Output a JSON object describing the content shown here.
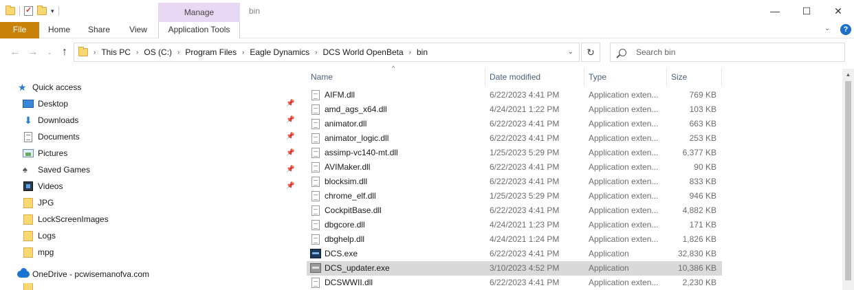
{
  "window": {
    "title": "bin",
    "context_tab": "Manage",
    "controls": {
      "minimize": "—",
      "maximize": "☐",
      "close": "✕"
    }
  },
  "ribbon": {
    "tabs": [
      {
        "label": "File"
      },
      {
        "label": "Home"
      },
      {
        "label": "Share"
      },
      {
        "label": "View"
      },
      {
        "label": "Application Tools"
      }
    ],
    "help_label": "?",
    "accent_color": "#c9830a",
    "context_color": "#e8d8f3"
  },
  "address": {
    "breadcrumbs": [
      "This PC",
      "OS (C:)",
      "Program Files",
      "Eagle Dynamics",
      "DCS World OpenBeta",
      "bin"
    ],
    "search_placeholder": "Search bin"
  },
  "nav_pane": {
    "quick_access_label": "Quick access",
    "items": [
      {
        "label": "Desktop",
        "icon": "desktop-icon",
        "pinned": true
      },
      {
        "label": "Downloads",
        "icon": "download-icon",
        "pinned": true
      },
      {
        "label": "Documents",
        "icon": "documents-icon",
        "pinned": true
      },
      {
        "label": "Pictures",
        "icon": "pictures-icon",
        "pinned": true
      },
      {
        "label": "Saved Games",
        "icon": "saved-games-icon",
        "pinned": true
      },
      {
        "label": "Videos",
        "icon": "videos-icon",
        "pinned": true
      },
      {
        "label": "JPG",
        "icon": "folder-icon",
        "pinned": false
      },
      {
        "label": "LockScreenImages",
        "icon": "folder-icon",
        "pinned": false
      },
      {
        "label": "Logs",
        "icon": "folder-icon",
        "pinned": false
      },
      {
        "label": "mpg",
        "icon": "folder-icon",
        "pinned": false
      }
    ],
    "onedrive_label": "OneDrive - pcwisemanofva.com"
  },
  "file_list": {
    "columns": {
      "name": "Name",
      "date": "Date modified",
      "type": "Type",
      "size": "Size"
    },
    "rows": [
      {
        "name": "AIFM.dll",
        "date": "6/22/2023 4:41 PM",
        "type": "Application exten...",
        "size": "769 KB",
        "icon": "dll-file-icon"
      },
      {
        "name": "amd_ags_x64.dll",
        "date": "4/24/2021 1:22 PM",
        "type": "Application exten...",
        "size": "103 KB",
        "icon": "dll-file-icon"
      },
      {
        "name": "animator.dll",
        "date": "6/22/2023 4:41 PM",
        "type": "Application exten...",
        "size": "663 KB",
        "icon": "dll-file-icon"
      },
      {
        "name": "animator_logic.dll",
        "date": "6/22/2023 4:41 PM",
        "type": "Application exten...",
        "size": "253 KB",
        "icon": "dll-file-icon"
      },
      {
        "name": "assimp-vc140-mt.dll",
        "date": "1/25/2023 5:29 PM",
        "type": "Application exten...",
        "size": "6,377 KB",
        "icon": "dll-file-icon"
      },
      {
        "name": "AVIMaker.dll",
        "date": "6/22/2023 4:41 PM",
        "type": "Application exten...",
        "size": "90 KB",
        "icon": "dll-file-icon"
      },
      {
        "name": "blocksim.dll",
        "date": "6/22/2023 4:41 PM",
        "type": "Application exten...",
        "size": "833 KB",
        "icon": "dll-file-icon"
      },
      {
        "name": "chrome_elf.dll",
        "date": "1/25/2023 5:29 PM",
        "type": "Application exten...",
        "size": "946 KB",
        "icon": "dll-file-icon"
      },
      {
        "name": "CockpitBase.dll",
        "date": "6/22/2023 4:41 PM",
        "type": "Application exten...",
        "size": "4,882 KB",
        "icon": "dll-file-icon"
      },
      {
        "name": "dbgcore.dll",
        "date": "4/24/2021 1:23 PM",
        "type": "Application exten...",
        "size": "171 KB",
        "icon": "dll-file-icon"
      },
      {
        "name": "dbghelp.dll",
        "date": "4/24/2021 1:24 PM",
        "type": "Application exten...",
        "size": "1,826 KB",
        "icon": "dll-file-icon"
      },
      {
        "name": "DCS.exe",
        "date": "6/22/2023 4:41 PM",
        "type": "Application",
        "size": "32,830 KB",
        "icon": "dcs-exe-icon"
      },
      {
        "name": "DCS_updater.exe",
        "date": "3/10/2023 4:52 PM",
        "type": "Application",
        "size": "10,386 KB",
        "icon": "dcs-updater-icon",
        "selected": true
      },
      {
        "name": "DCSWWII.dll",
        "date": "6/22/2023 4:41 PM",
        "type": "Application exten...",
        "size": "2,230 KB",
        "icon": "dll-file-icon"
      }
    ]
  }
}
